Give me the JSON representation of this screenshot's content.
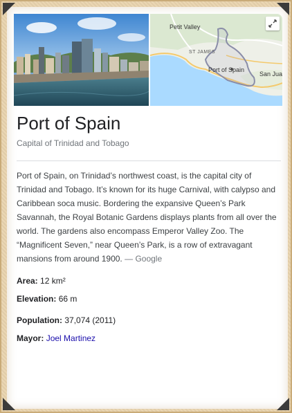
{
  "place": {
    "title": "Port of Spain",
    "subtitle": "Capital of Trinidad and Tobago",
    "description": "Port of Spain, on Trinidad’s northwest coast, is the capital city of Trinidad and Tobago. It’s known for its huge Carnival, with calypso and Caribbean soca music. Bordering the expansive Queen’s Park Savannah, the Royal Botanic Gardens displays plants from all over the world. The gardens also encompass Emperor Valley Zoo. The “Magnificent Seven,” near Queen’s Park, is a row of extravagant mansions from around 1900.",
    "source": "— Google"
  },
  "map": {
    "labels": {
      "petit_valley": "Petit Valley",
      "st_james": "ST JAMES",
      "port_of_spain": "Port of Spain",
      "san_juan": "San Jua"
    },
    "expand_icon": "expand-icon"
  },
  "facts": {
    "area_label": "Area:",
    "area_value": "12 km²",
    "elevation_label": "Elevation:",
    "elevation_value": "66 m",
    "population_label": "Population:",
    "population_value": "37,074 (2011)",
    "mayor_label": "Mayor:",
    "mayor_value": "Joel Martinez"
  },
  "colors": {
    "link": "#1a0dab",
    "title": "#202124",
    "muted": "#70757a",
    "water": "#aadaff",
    "boundary": "#8a8da8"
  }
}
